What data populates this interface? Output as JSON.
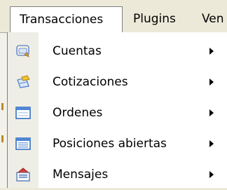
{
  "menubar": {
    "items": [
      {
        "label": "Transacciones"
      },
      {
        "label": "Plugins"
      },
      {
        "label": "Ven"
      }
    ]
  },
  "dropdown": {
    "items": [
      {
        "label": "Cuentas",
        "icon": "accounts-icon"
      },
      {
        "label": "Cotizaciones",
        "icon": "quotes-icon"
      },
      {
        "label": "Ordenes",
        "icon": "orders-icon"
      },
      {
        "label": "Posiciones abiertas",
        "icon": "open-positions-icon"
      },
      {
        "label": "Mensajes",
        "icon": "messages-icon"
      }
    ]
  }
}
